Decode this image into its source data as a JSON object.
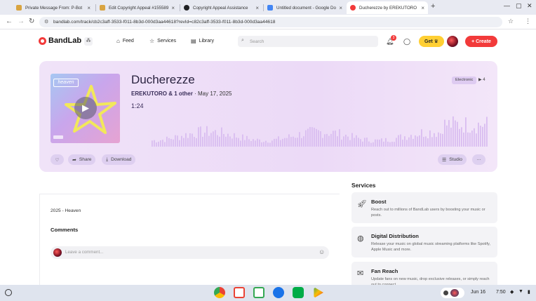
{
  "browser": {
    "tabs": [
      {
        "title": "Private Message From: P-Bot",
        "fav_color": "#d9a441",
        "active": false
      },
      {
        "title": "Edit Copyright Appeal #155589",
        "fav_color": "#d9a441",
        "active": false
      },
      {
        "title": "Copyright Appeal Assistance",
        "fav_color": "#202124",
        "active": false
      },
      {
        "title": "Untitled document - Google Do",
        "fav_color": "#4285f4",
        "active": false
      },
      {
        "title": "Ducherezze by EREKUTORO | B",
        "fav_color": "#f23a3a",
        "active": true
      }
    ],
    "new_tab": "+",
    "url": "bandlab.com/track/cb2c3aff-3533-f011-8b3d-000d3aa44618?revId=c82c3aff-3533-f011-8b3d-000d3aa44618"
  },
  "header": {
    "brand": "BandLab",
    "nav": [
      {
        "label": "Feed",
        "icon": "home-icon"
      },
      {
        "label": "Services",
        "icon": "star-icon"
      },
      {
        "label": "Library",
        "icon": "library-icon"
      }
    ],
    "search_placeholder": "Search",
    "notification_count": "3",
    "get_label": "Get",
    "create_label": "Create"
  },
  "track": {
    "title": "Ducherezze",
    "artist": "EREKUTORO & 1 other",
    "date": "· May 17, 2025",
    "duration": "1:24",
    "genre": "Electronic",
    "plays": "4",
    "cover_text": "heaven",
    "actions": {
      "share": "Share",
      "download": "Download",
      "studio": "Studio",
      "more": "···"
    }
  },
  "description": "2025 - Heaven",
  "comments": {
    "heading": "Comments",
    "placeholder": "Leave a comment..."
  },
  "services": {
    "heading": "Services",
    "items": [
      {
        "title": "Boost",
        "desc": "Reach out to millions of BandLab users by boosting your music or posts.",
        "icon": "rocket-icon"
      },
      {
        "title": "Digital Distribution",
        "desc": "Release your music on global music streaming platforms like Spotify, Apple Music and more.",
        "icon": "globe-icon"
      },
      {
        "title": "Fan Reach",
        "desc": "Update fans on new music, drop exclusive releases, or simply reach out to connect.",
        "icon": "mail-icon"
      }
    ]
  },
  "shelf": {
    "date": "Jun 16",
    "time": "7:50",
    "apps": [
      {
        "name": "chrome",
        "color": "#4285f4"
      },
      {
        "name": "gmail",
        "color": "#ea4335"
      },
      {
        "name": "docs",
        "color": "#34a853"
      },
      {
        "name": "files",
        "color": "#1a73e8"
      },
      {
        "name": "meet",
        "color": "#00ac47"
      },
      {
        "name": "play",
        "color": "#fbbc04"
      }
    ]
  }
}
